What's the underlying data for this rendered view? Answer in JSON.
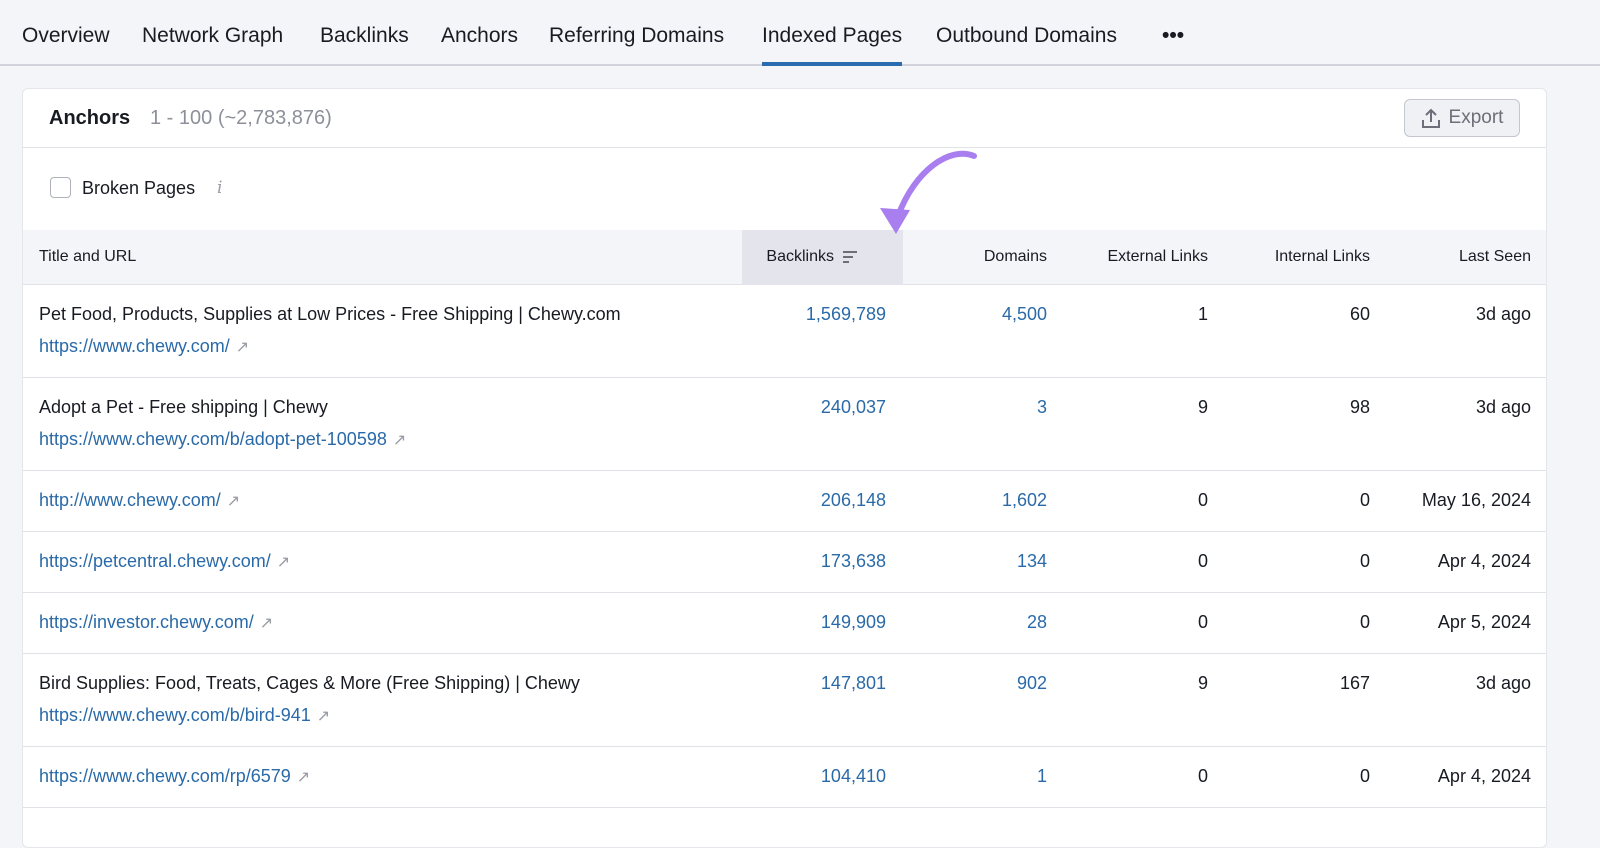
{
  "tabs": [
    "Overview",
    "Network Graph",
    "Backlinks",
    "Anchors",
    "Referring Domains",
    "Indexed Pages",
    "Outbound Domains"
  ],
  "more_label": "•••",
  "active_tab": "Indexed Pages",
  "card": {
    "title": "Anchors",
    "count": "1 - 100 (~2,783,876)",
    "export_label": "Export"
  },
  "filter": {
    "broken_pages": "Broken Pages",
    "info": "i"
  },
  "columns": [
    "Title and URL",
    "Backlinks",
    "Domains",
    "External Links",
    "Internal Links",
    "Last Seen"
  ],
  "rows": [
    {
      "title": "Pet Food, Products, Supplies at Low Prices - Free Shipping | Chewy.com",
      "url": "https://www.chewy.com/",
      "backlinks": "1,569,789",
      "domains": "4,500",
      "external": "1",
      "internal": "60",
      "last_seen": "3d ago"
    },
    {
      "title": "Adopt a Pet - Free shipping | Chewy",
      "url": "https://www.chewy.com/b/adopt-pet-100598",
      "backlinks": "240,037",
      "domains": "3",
      "external": "9",
      "internal": "98",
      "last_seen": "3d ago"
    },
    {
      "title": "",
      "url": "http://www.chewy.com/",
      "backlinks": "206,148",
      "domains": "1,602",
      "external": "0",
      "internal": "0",
      "last_seen": "May 16, 2024"
    },
    {
      "title": "",
      "url": "https://petcentral.chewy.com/",
      "backlinks": "173,638",
      "domains": "134",
      "external": "0",
      "internal": "0",
      "last_seen": "Apr 4, 2024"
    },
    {
      "title": "",
      "url": "https://investor.chewy.com/",
      "backlinks": "149,909",
      "domains": "28",
      "external": "0",
      "internal": "0",
      "last_seen": "Apr 5, 2024"
    },
    {
      "title": "Bird Supplies: Food, Treats, Cages & More (Free Shipping) | Chewy",
      "url": "https://www.chewy.com/b/bird-941",
      "backlinks": "147,801",
      "domains": "902",
      "external": "9",
      "internal": "167",
      "last_seen": "3d ago"
    },
    {
      "title": "",
      "url": "https://www.chewy.com/rp/6579",
      "backlinks": "104,410",
      "domains": "1",
      "external": "0",
      "internal": "0",
      "last_seen": "Apr 4, 2024"
    }
  ],
  "colors": {
    "link": "#2a6aa8",
    "accent": "#2b6cb0",
    "arrow": "#a97ff0"
  }
}
